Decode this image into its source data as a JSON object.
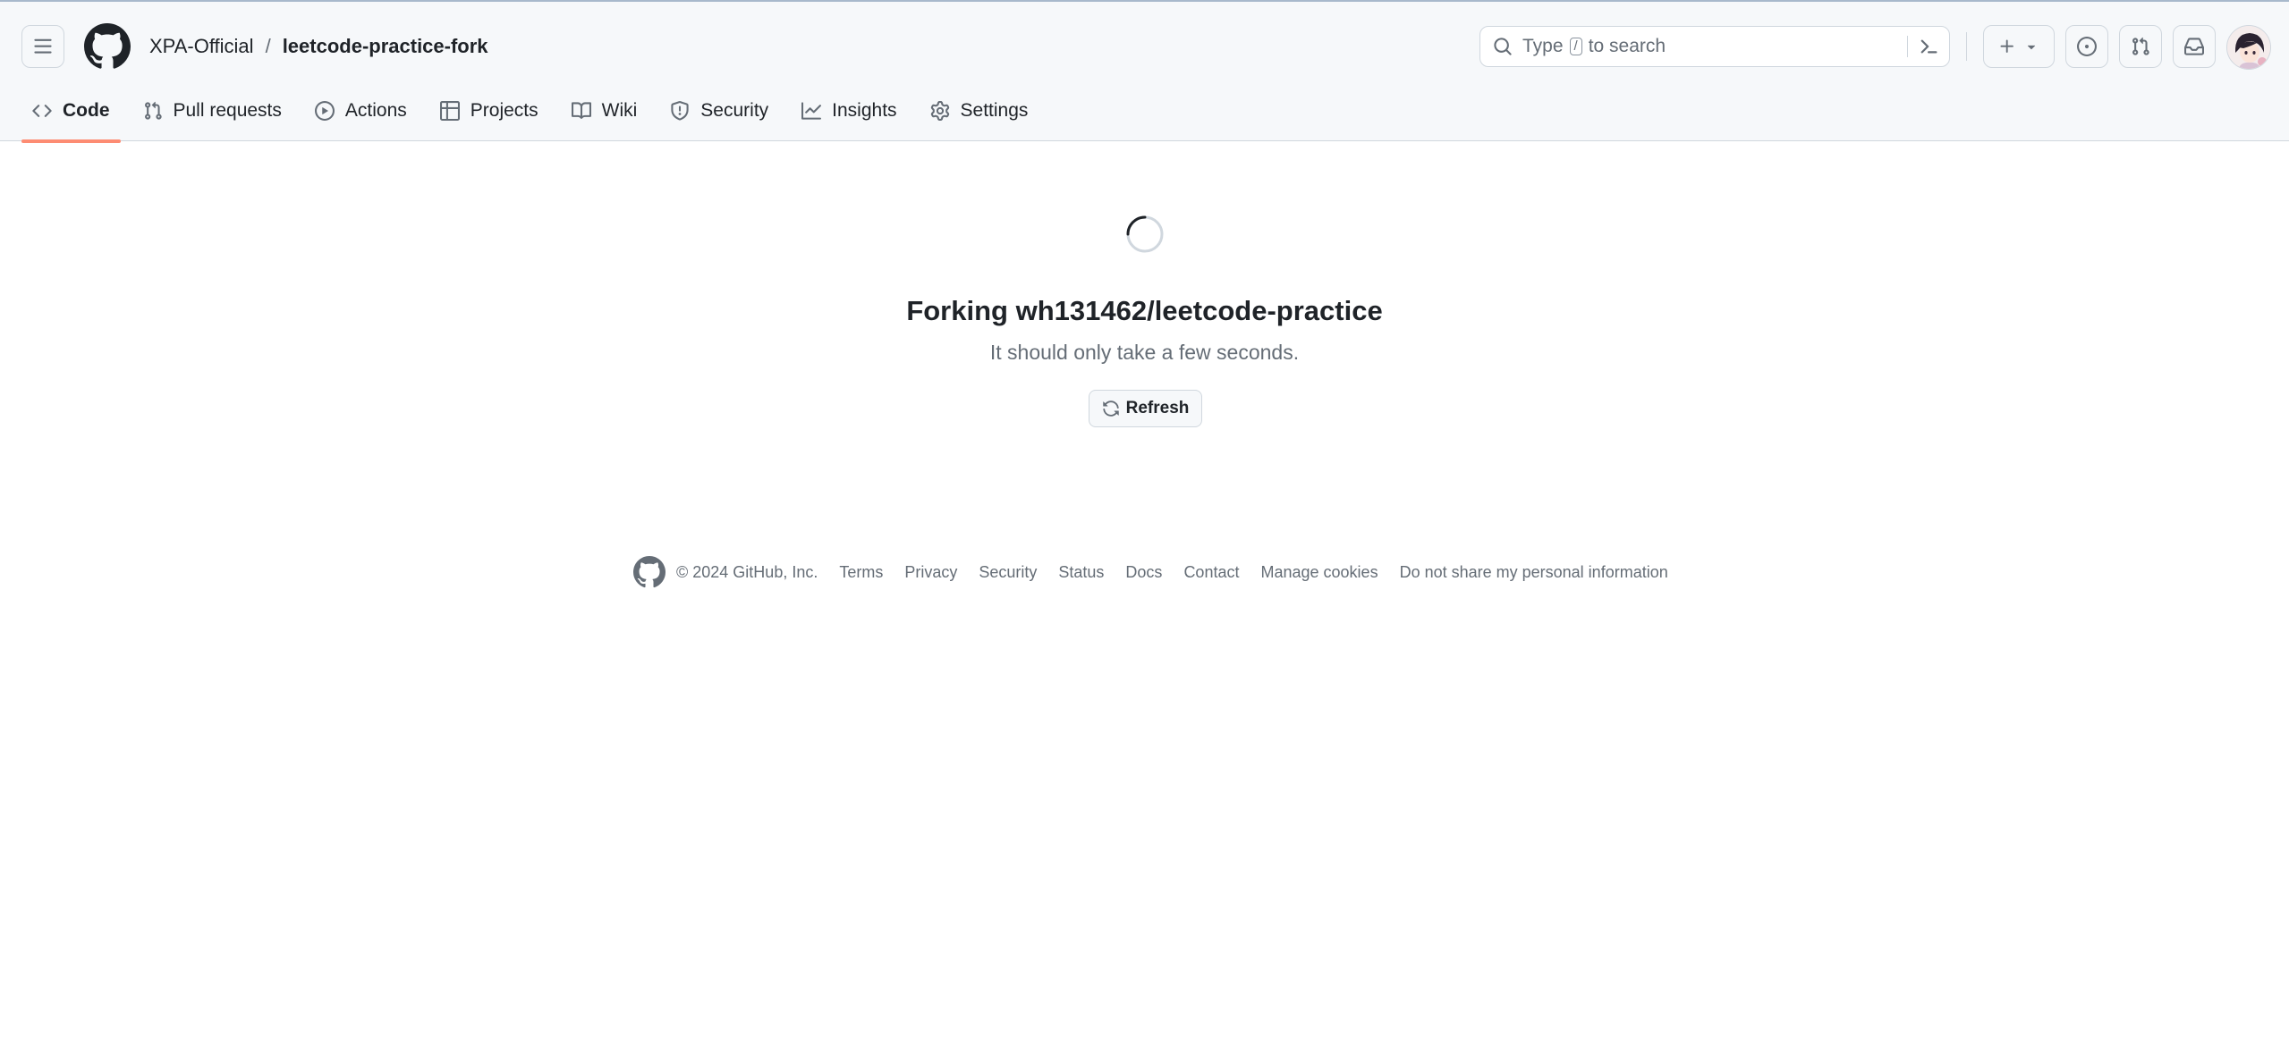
{
  "header": {
    "owner": "XPA-Official",
    "separator": "/",
    "repo": "leetcode-practice-fork",
    "search": {
      "prefix": "Type",
      "key": "/",
      "suffix": "to search"
    }
  },
  "nav": {
    "tabs": [
      {
        "label": "Code",
        "icon": "code-icon",
        "selected": true
      },
      {
        "label": "Pull requests",
        "icon": "git-pull-request-icon",
        "selected": false
      },
      {
        "label": "Actions",
        "icon": "play-icon",
        "selected": false
      },
      {
        "label": "Projects",
        "icon": "table-icon",
        "selected": false
      },
      {
        "label": "Wiki",
        "icon": "book-icon",
        "selected": false
      },
      {
        "label": "Security",
        "icon": "shield-icon",
        "selected": false
      },
      {
        "label": "Insights",
        "icon": "graph-icon",
        "selected": false
      },
      {
        "label": "Settings",
        "icon": "gear-icon",
        "selected": false
      }
    ]
  },
  "main": {
    "title": "Forking wh131462/leetcode-practice",
    "subtitle": "It should only take a few seconds.",
    "refresh_label": "Refresh"
  },
  "footer": {
    "copyright": "© 2024 GitHub, Inc.",
    "links": [
      "Terms",
      "Privacy",
      "Security",
      "Status",
      "Docs",
      "Contact",
      "Manage cookies",
      "Do not share my personal information"
    ]
  },
  "colors": {
    "header_bg": "#f6f8fa",
    "selected_tab_underline": "#fd8c73",
    "muted_text": "#656d76",
    "border": "#d0d7de"
  }
}
